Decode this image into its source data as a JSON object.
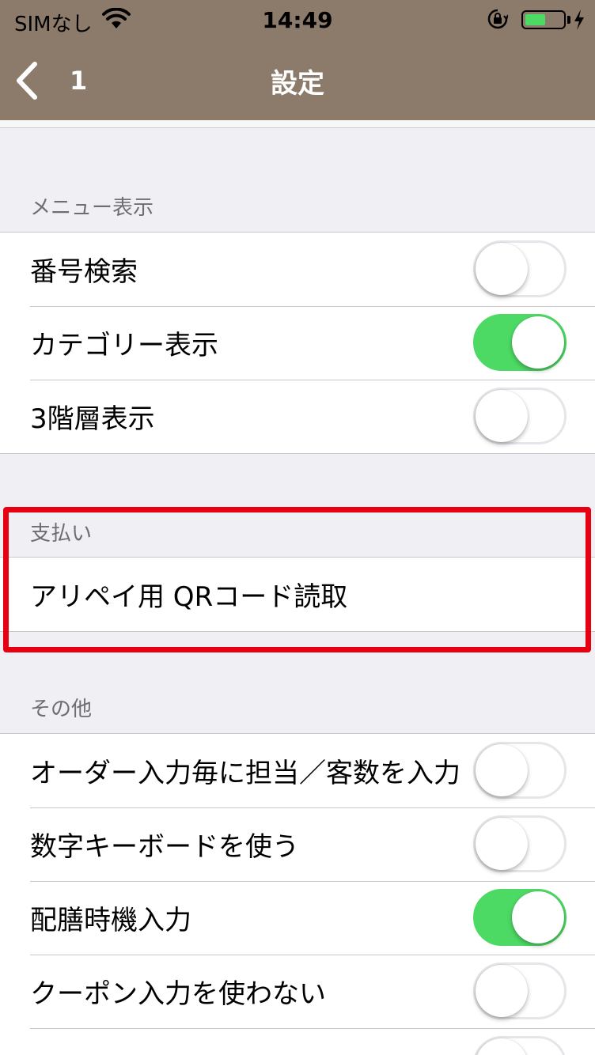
{
  "status_bar": {
    "carrier": "SIMなし",
    "time": "14:49",
    "battery_level": 0.55,
    "battery_color": "#4cd964"
  },
  "nav": {
    "back_label": "1",
    "title": "設定",
    "bar_color": "#8c7b6b"
  },
  "sections": {
    "menu": {
      "header": "メニュー表示",
      "items": [
        {
          "label": "番号検索",
          "on": false
        },
        {
          "label": "カテゴリー表示",
          "on": true
        },
        {
          "label": "3階層表示",
          "on": false
        }
      ]
    },
    "payment": {
      "header": "支払い",
      "items": [
        {
          "label": "アリペイ用 QRコード読取"
        }
      ]
    },
    "other": {
      "header": "その他",
      "items": [
        {
          "label": "オーダー入力毎に担当／客数を入力",
          "on": false
        },
        {
          "label": "数字キーボードを使う",
          "on": false
        },
        {
          "label": "配膳時機入力",
          "on": true
        },
        {
          "label": "クーポン入力を使わない",
          "on": false
        },
        {
          "label": "",
          "on": false
        }
      ]
    }
  },
  "colors": {
    "switch_on": "#4cd964",
    "highlight": "#e60012"
  }
}
